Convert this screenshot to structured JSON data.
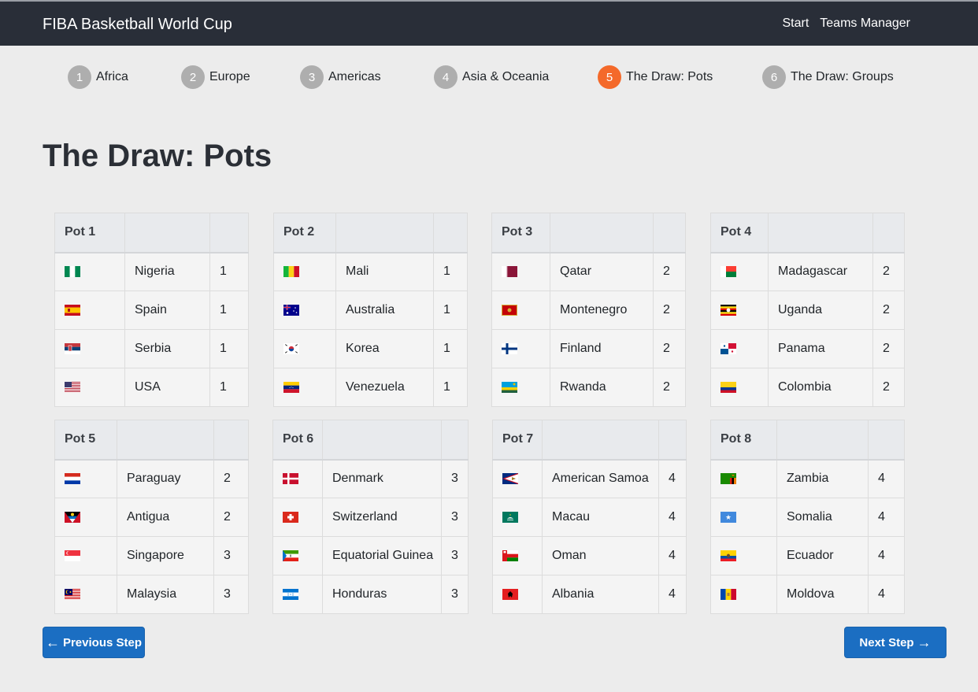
{
  "app": {
    "brand": "FIBA Basketball World Cup",
    "nav": [
      "Start",
      "Teams Manager"
    ]
  },
  "steps": [
    {
      "num": "1",
      "label": "Africa",
      "active": false
    },
    {
      "num": "2",
      "label": "Europe",
      "active": false
    },
    {
      "num": "3",
      "label": "Americas",
      "active": false
    },
    {
      "num": "4",
      "label": "Asia & Oceania",
      "active": false
    },
    {
      "num": "5",
      "label": "The Draw: Pots",
      "active": true
    },
    {
      "num": "6",
      "label": "The Draw: Groups",
      "active": false
    }
  ],
  "page": {
    "title": "The Draw: Pots"
  },
  "pots": [
    {
      "name": "Pot 1",
      "teams": [
        {
          "flag": "nigeria-flag-icon",
          "country": "Nigeria",
          "rank": "1"
        },
        {
          "flag": "spain-flag-icon",
          "country": "Spain",
          "rank": "1"
        },
        {
          "flag": "serbia-flag-icon",
          "country": "Serbia",
          "rank": "1"
        },
        {
          "flag": "usa-flag-icon",
          "country": "USA",
          "rank": "1"
        }
      ]
    },
    {
      "name": "Pot 2",
      "teams": [
        {
          "flag": "mali-flag-icon",
          "country": "Mali",
          "rank": "1"
        },
        {
          "flag": "australia-flag-icon",
          "country": "Australia",
          "rank": "1"
        },
        {
          "flag": "korea-flag-icon",
          "country": "Korea",
          "rank": "1"
        },
        {
          "flag": "venezuela-flag-icon",
          "country": "Venezuela",
          "rank": "1"
        }
      ]
    },
    {
      "name": "Pot 3",
      "teams": [
        {
          "flag": "qatar-flag-icon",
          "country": "Qatar",
          "rank": "2"
        },
        {
          "flag": "montenegro-flag-icon",
          "country": "Montenegro",
          "rank": "2"
        },
        {
          "flag": "finland-flag-icon",
          "country": "Finland",
          "rank": "2"
        },
        {
          "flag": "rwanda-flag-icon",
          "country": "Rwanda",
          "rank": "2"
        }
      ]
    },
    {
      "name": "Pot 4",
      "teams": [
        {
          "flag": "madagascar-flag-icon",
          "country": "Madagascar",
          "rank": "2"
        },
        {
          "flag": "uganda-flag-icon",
          "country": "Uganda",
          "rank": "2"
        },
        {
          "flag": "panama-flag-icon",
          "country": "Panama",
          "rank": "2"
        },
        {
          "flag": "colombia-flag-icon",
          "country": "Colombia",
          "rank": "2"
        }
      ]
    },
    {
      "name": "Pot 5",
      "teams": [
        {
          "flag": "paraguay-flag-icon",
          "country": "Paraguay",
          "rank": "2"
        },
        {
          "flag": "antigua-flag-icon",
          "country": "Antigua",
          "rank": "2"
        },
        {
          "flag": "singapore-flag-icon",
          "country": "Singapore",
          "rank": "3"
        },
        {
          "flag": "malaysia-flag-icon",
          "country": "Malaysia",
          "rank": "3"
        }
      ]
    },
    {
      "name": "Pot 6",
      "teams": [
        {
          "flag": "denmark-flag-icon",
          "country": "Denmark",
          "rank": "3"
        },
        {
          "flag": "switzerland-flag-icon",
          "country": "Switzerland",
          "rank": "3"
        },
        {
          "flag": "equatorial-guinea-flag-icon",
          "country": "Equatorial Guinea",
          "rank": "3"
        },
        {
          "flag": "honduras-flag-icon",
          "country": "Honduras",
          "rank": "3"
        }
      ]
    },
    {
      "name": "Pot 7",
      "teams": [
        {
          "flag": "american-samoa-flag-icon",
          "country": "American Samoa",
          "rank": "4"
        },
        {
          "flag": "macau-flag-icon",
          "country": "Macau",
          "rank": "4"
        },
        {
          "flag": "oman-flag-icon",
          "country": "Oman",
          "rank": "4"
        },
        {
          "flag": "albania-flag-icon",
          "country": "Albania",
          "rank": "4"
        }
      ]
    },
    {
      "name": "Pot 8",
      "teams": [
        {
          "flag": "zambia-flag-icon",
          "country": "Zambia",
          "rank": "4"
        },
        {
          "flag": "somalia-flag-icon",
          "country": "Somalia",
          "rank": "4"
        },
        {
          "flag": "ecuador-flag-icon",
          "country": "Ecuador",
          "rank": "4"
        },
        {
          "flag": "moldova-flag-icon",
          "country": "Moldova",
          "rank": "4"
        }
      ]
    }
  ],
  "buttons": {
    "previous": "Previous Step",
    "next": "Next Step"
  },
  "colors": {
    "navbar": "#292e38",
    "active_step": "#f4692a",
    "inactive_step": "#aeaeae",
    "button": "#1b6ec2"
  }
}
